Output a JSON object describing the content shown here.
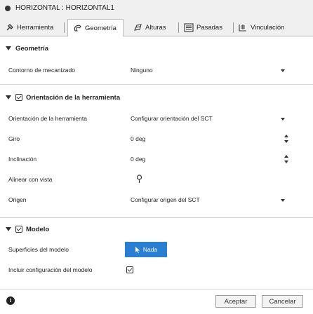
{
  "window": {
    "title": "HORIZONTAL : HORIZONTAL1"
  },
  "tabs": [
    {
      "label": "Herramienta",
      "icon": "tool-icon"
    },
    {
      "label": "Geometría",
      "icon": "geometry-icon",
      "active": true
    },
    {
      "label": "Alturas",
      "icon": "heights-icon"
    },
    {
      "label": "Pasadas",
      "icon": "passes-icon"
    },
    {
      "label": "Vinculación",
      "icon": "linking-icon"
    }
  ],
  "geometry_section": {
    "title": "Geometría",
    "contour_label": "Contorno de mecanizado",
    "contour_value": "Ninguno"
  },
  "orientation_section": {
    "title": "Orientación de la herramienta",
    "checked": true,
    "orientation_label": "Orientación de la herramienta",
    "orientation_value": "Configurar orientación del SCT",
    "rotation_label": "Giro",
    "rotation_value": "0 deg",
    "tilt_label": "Inclinación",
    "tilt_value": "0 deg",
    "align_label": "Alinear con vista",
    "origin_label": "Origen",
    "origin_value": "Configurar origen del SCT"
  },
  "model_section": {
    "title": "Modelo",
    "checked": true,
    "surfaces_label": "Superficies del modelo",
    "surfaces_button": "Nada",
    "include_label": "Incluir configuración del modelo",
    "include_checked": true
  },
  "footer": {
    "info_icon": "info-icon",
    "accept_label": "Aceptar",
    "cancel_label": "Cancelar"
  },
  "colors": {
    "accent": "#2a7fd3",
    "panel_bg": "#f0f0f0"
  }
}
